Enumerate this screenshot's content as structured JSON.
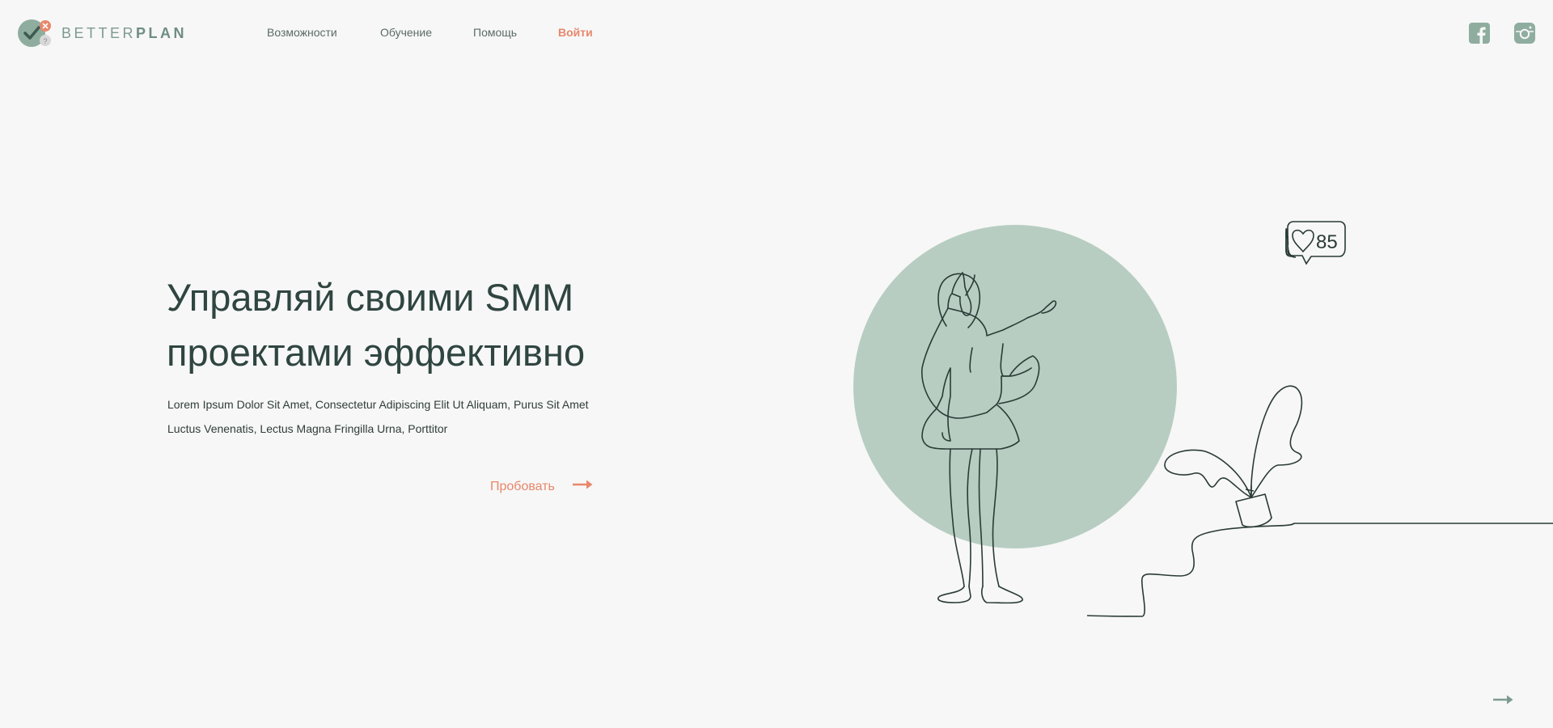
{
  "brand": {
    "name_light": "BETTER",
    "name_bold": "PLAN"
  },
  "nav": {
    "items": [
      "Возможности",
      "Обучение",
      "Помощь"
    ],
    "login_label": "Войти"
  },
  "social": {
    "icons": [
      "facebook-icon",
      "instagram-icon"
    ]
  },
  "hero": {
    "title_line1": "Управляй своими SMM",
    "title_line2": "проектами эффективно",
    "text_line1": "Lorem Ipsum Dolor Sit Amet, Consectetur Adipiscing Elit Ut Aliquam, Purus Sit Amet",
    "text_line2": "Luctus Venenatis, Lectus Magna Fringilla Urna, Porttitor",
    "cta_label": "Пробовать"
  },
  "illustration": {
    "likes_count": "85"
  },
  "colors": {
    "accent": "#e8876b",
    "brand_green": "#7d9a90",
    "circle": "#b7cdc1",
    "line": "#2a3b36",
    "background": "#f7f7f7"
  }
}
